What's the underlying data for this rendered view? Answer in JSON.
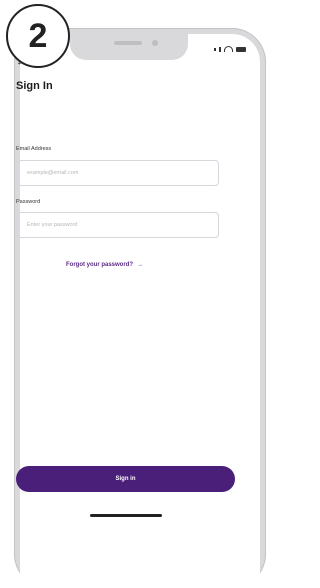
{
  "step_badge": "2",
  "nav": {
    "back_icon": "←"
  },
  "page": {
    "title": "Sign In"
  },
  "email": {
    "label": "Email Address",
    "placeholder": "example@email.com"
  },
  "password": {
    "label": "Password",
    "placeholder": "Enter your password"
  },
  "forgot": {
    "label": "Forgot your password?",
    "arrow": "→"
  },
  "primary_button": {
    "label": "Sign in"
  },
  "colors": {
    "brand": "#4a1f7a",
    "link": "#5b2a86"
  }
}
